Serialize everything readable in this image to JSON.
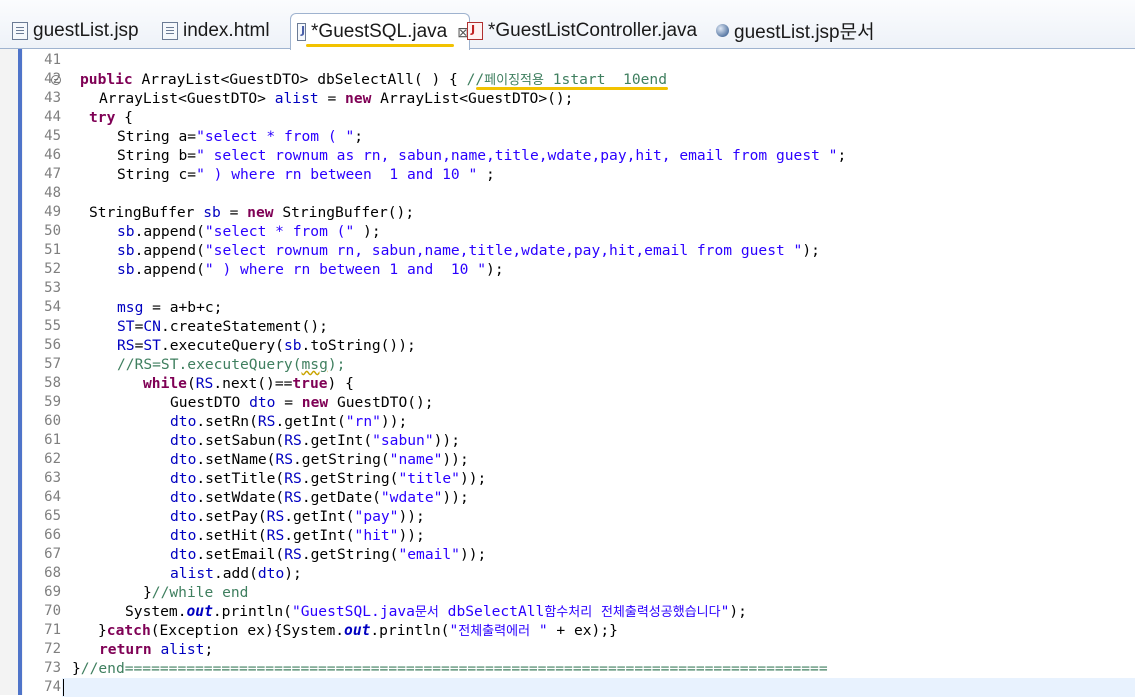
{
  "tabs": [
    {
      "label": "guestList.jsp",
      "icon": "jsp-file-icon"
    },
    {
      "label": "index.html",
      "icon": "html-file-icon"
    },
    {
      "label": "*GuestSQL.java",
      "icon": "java-file-icon",
      "active": true,
      "close": "⊠"
    },
    {
      "label": "*GuestListController.java",
      "icon": "java-error-file-icon"
    },
    {
      "label": "guestList.jsp문서",
      "icon": "globe-icon"
    }
  ],
  "lines": [
    {
      "n": "41",
      "t": ""
    },
    {
      "n": "42",
      "t": "public ArrayList<GuestDTO> dbSelectAll( ) { //페이징적용 1start  10end"
    },
    {
      "n": "43",
      "t": "ArrayList<GuestDTO> alist = new ArrayList<GuestDTO>();"
    },
    {
      "n": "44",
      "t": "try {"
    },
    {
      "n": "45",
      "t": "String a=\"select * from ( \";"
    },
    {
      "n": "46",
      "t": "String b=\" select rownum as rn, sabun,name,title,wdate,pay,hit, email from guest \";"
    },
    {
      "n": "47",
      "t": "String c=\" ) where rn between  1 and 10 \" ;"
    },
    {
      "n": "48",
      "t": ""
    },
    {
      "n": "49",
      "t": "StringBuffer sb = new StringBuffer();"
    },
    {
      "n": "50",
      "t": "sb.append(\"select * from (\" );"
    },
    {
      "n": "51",
      "t": "sb.append(\"select rownum rn, sabun,name,title,wdate,pay,hit,email from guest \");"
    },
    {
      "n": "52",
      "t": "sb.append(\" ) where rn between 1 and  10 \");"
    },
    {
      "n": "53",
      "t": ""
    },
    {
      "n": "54",
      "t": "msg = a+b+c;"
    },
    {
      "n": "55",
      "t": "ST=CN.createStatement();"
    },
    {
      "n": "56",
      "t": "RS=ST.executeQuery(sb.toString());"
    },
    {
      "n": "57",
      "t": "//RS=ST.executeQuery(msg);"
    },
    {
      "n": "58",
      "t": "while(RS.next()==true) {"
    },
    {
      "n": "59",
      "t": "GuestDTO dto = new GuestDTO();"
    },
    {
      "n": "60",
      "t": "dto.setRn(RS.getInt(\"rn\"));"
    },
    {
      "n": "61",
      "t": "dto.setSabun(RS.getInt(\"sabun\"));"
    },
    {
      "n": "62",
      "t": "dto.setName(RS.getString(\"name\"));"
    },
    {
      "n": "63",
      "t": "dto.setTitle(RS.getString(\"title\"));"
    },
    {
      "n": "64",
      "t": "dto.setWdate(RS.getDate(\"wdate\"));"
    },
    {
      "n": "65",
      "t": "dto.setPay(RS.getInt(\"pay\"));"
    },
    {
      "n": "66",
      "t": "dto.setHit(RS.getInt(\"hit\"));"
    },
    {
      "n": "67",
      "t": "dto.setEmail(RS.getString(\"email\"));"
    },
    {
      "n": "68",
      "t": "alist.add(dto);"
    },
    {
      "n": "69",
      "t": "}//while end"
    },
    {
      "n": "70",
      "t": "System.out.println(\"GuestSQL.java문서 dbSelectAll함수처리 전체출력성공했습니다\");"
    },
    {
      "n": "71",
      "t": "}catch(Exception ex){System.out.println(\"전체출력에러 \" + ex);}"
    },
    {
      "n": "72",
      "t": "return alist;"
    },
    {
      "n": "73",
      "t": "}//end================================================================================"
    },
    {
      "n": "74",
      "t": ""
    }
  ],
  "colors": {
    "keyword": "#7f0055",
    "string": "#2a00ff",
    "comment": "#3f7f5f",
    "field": "#0000c0",
    "highlight": "#f2c200"
  }
}
